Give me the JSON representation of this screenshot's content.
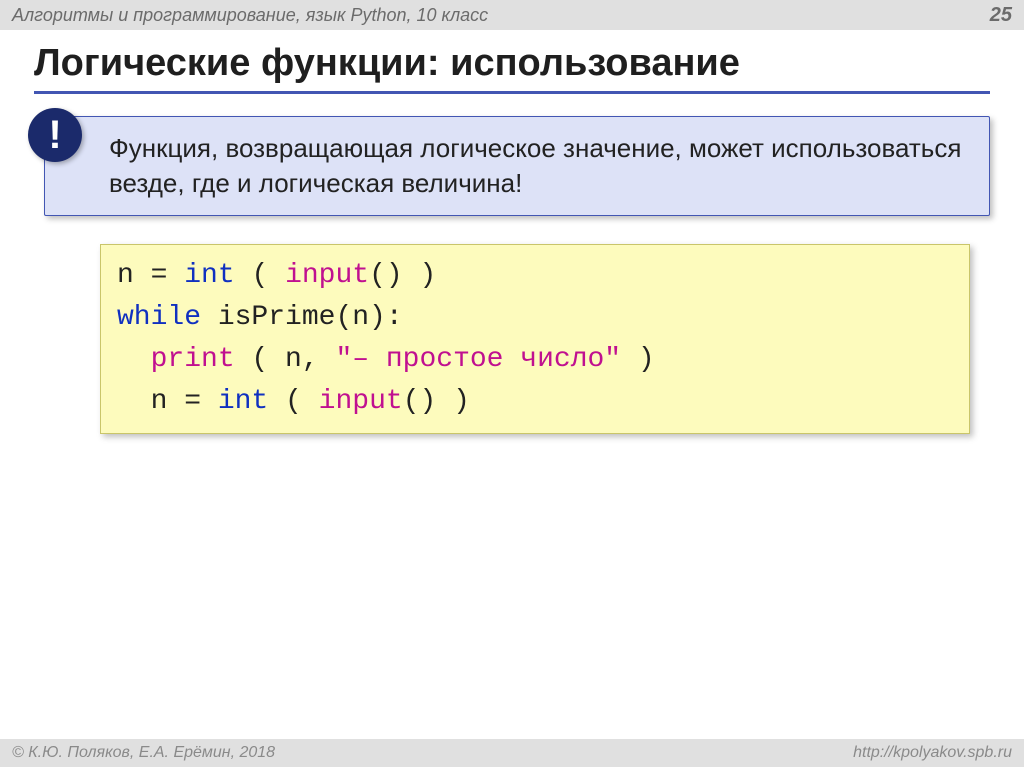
{
  "header": {
    "course": "Алгоритмы и программирование, язык Python, 10 класс",
    "page": "25"
  },
  "title": "Логические функции: использование",
  "callout": {
    "icon_label": "!",
    "text": "Функция, возвращающая логическое значение, может использоваться везде, где и логическая величина!"
  },
  "code": {
    "line1_a": "n = ",
    "line1_b": "int",
    "line1_c": " ( ",
    "line1_d": "input",
    "line1_e": "() )",
    "line2_a": "while",
    "line2_b": " isPrime(n):",
    "line3_a": "  ",
    "line3_b": "print",
    "line3_c": " ( n, ",
    "line3_d": "\"– простое число\"",
    "line3_e": " )",
    "line4_a": "  n = ",
    "line4_b": "int",
    "line4_c": " ( ",
    "line4_d": "input",
    "line4_e": "() )"
  },
  "footer": {
    "copyright": "© К.Ю. Поляков, Е.А. Ерёмин, 2018",
    "url": "http://kpolyakov.spb.ru"
  }
}
